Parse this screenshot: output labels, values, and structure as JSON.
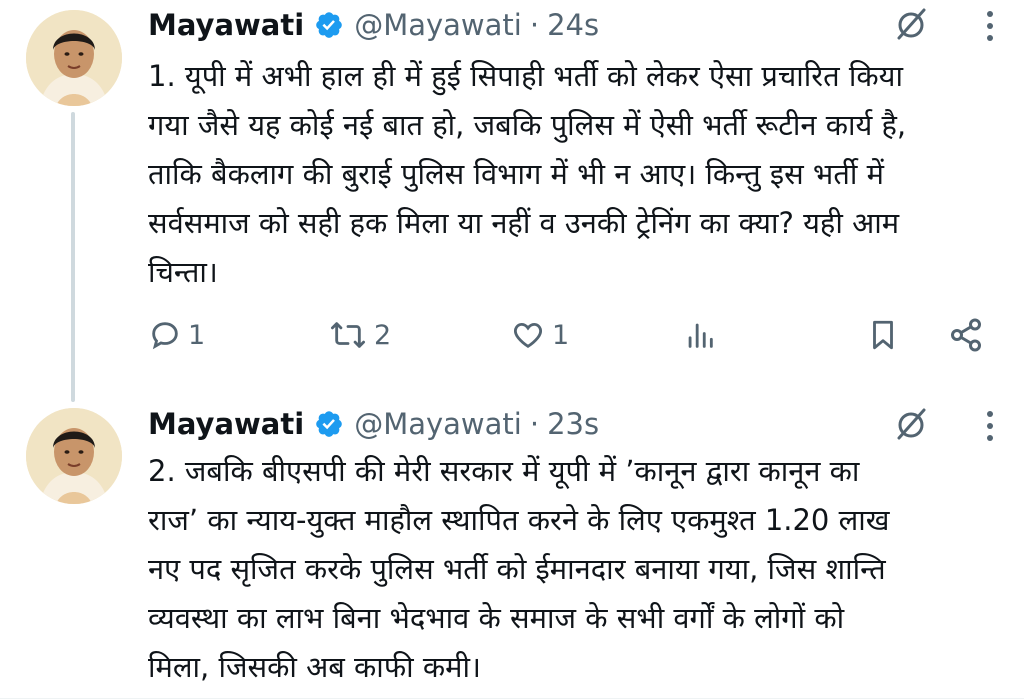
{
  "colors": {
    "text_primary": "#0f1419",
    "text_secondary": "#536471",
    "verified_blue": "#1d9bf0",
    "thread_line": "#cfd9de"
  },
  "tweets": [
    {
      "author_name": "Mayawati",
      "handle": "@Mayawati",
      "separator": "·",
      "time": "24s",
      "text": "1. यूपी में अभी हाल ही में हुई सिपाही भर्ती को लेकर ऐसा प्रचारित किया\nगया जैसे यह कोई नई बात हो, जबकि पुलिस में ऐसी भर्ती रूटीन कार्य है,\nताकि बैकलाग की बुराई पुलिस विभाग में भी न आए। किन्तु इस भर्ती में\nसर्वसमाज को सही हक मिला या नहीं व उनकी ट्रेनिंग का क्या? यही आम\nचिन्ता।",
      "reply_count": "1",
      "retweet_count": "2",
      "like_count": "1",
      "icons": [
        "verified-badge-icon",
        "grok-icon",
        "more-icon",
        "reply-icon",
        "retweet-icon",
        "like-icon",
        "views-icon",
        "bookmark-icon",
        "share-icon"
      ]
    },
    {
      "author_name": "Mayawati",
      "handle": "@Mayawati",
      "separator": "·",
      "time": "23s",
      "text": "2. जबकि बीएसपी की मेरी सरकार में यूपी में ’कानून द्वारा कानून का\nराज’ का न्याय-युक्त माहौल स्थापित करने के लिए एकमुश्त 1.20 लाख\nनए पद सृजित करके पुलिस भर्ती को ईमानदार बनाया गया, जिस शान्ति\nव्यवस्था का लाभ बिना भेदभाव के समाज के सभी वर्गों के लोगों को\nमिला, जिसकी अब काफी कमी।",
      "icons": [
        "verified-badge-icon",
        "grok-icon",
        "more-icon"
      ]
    }
  ]
}
